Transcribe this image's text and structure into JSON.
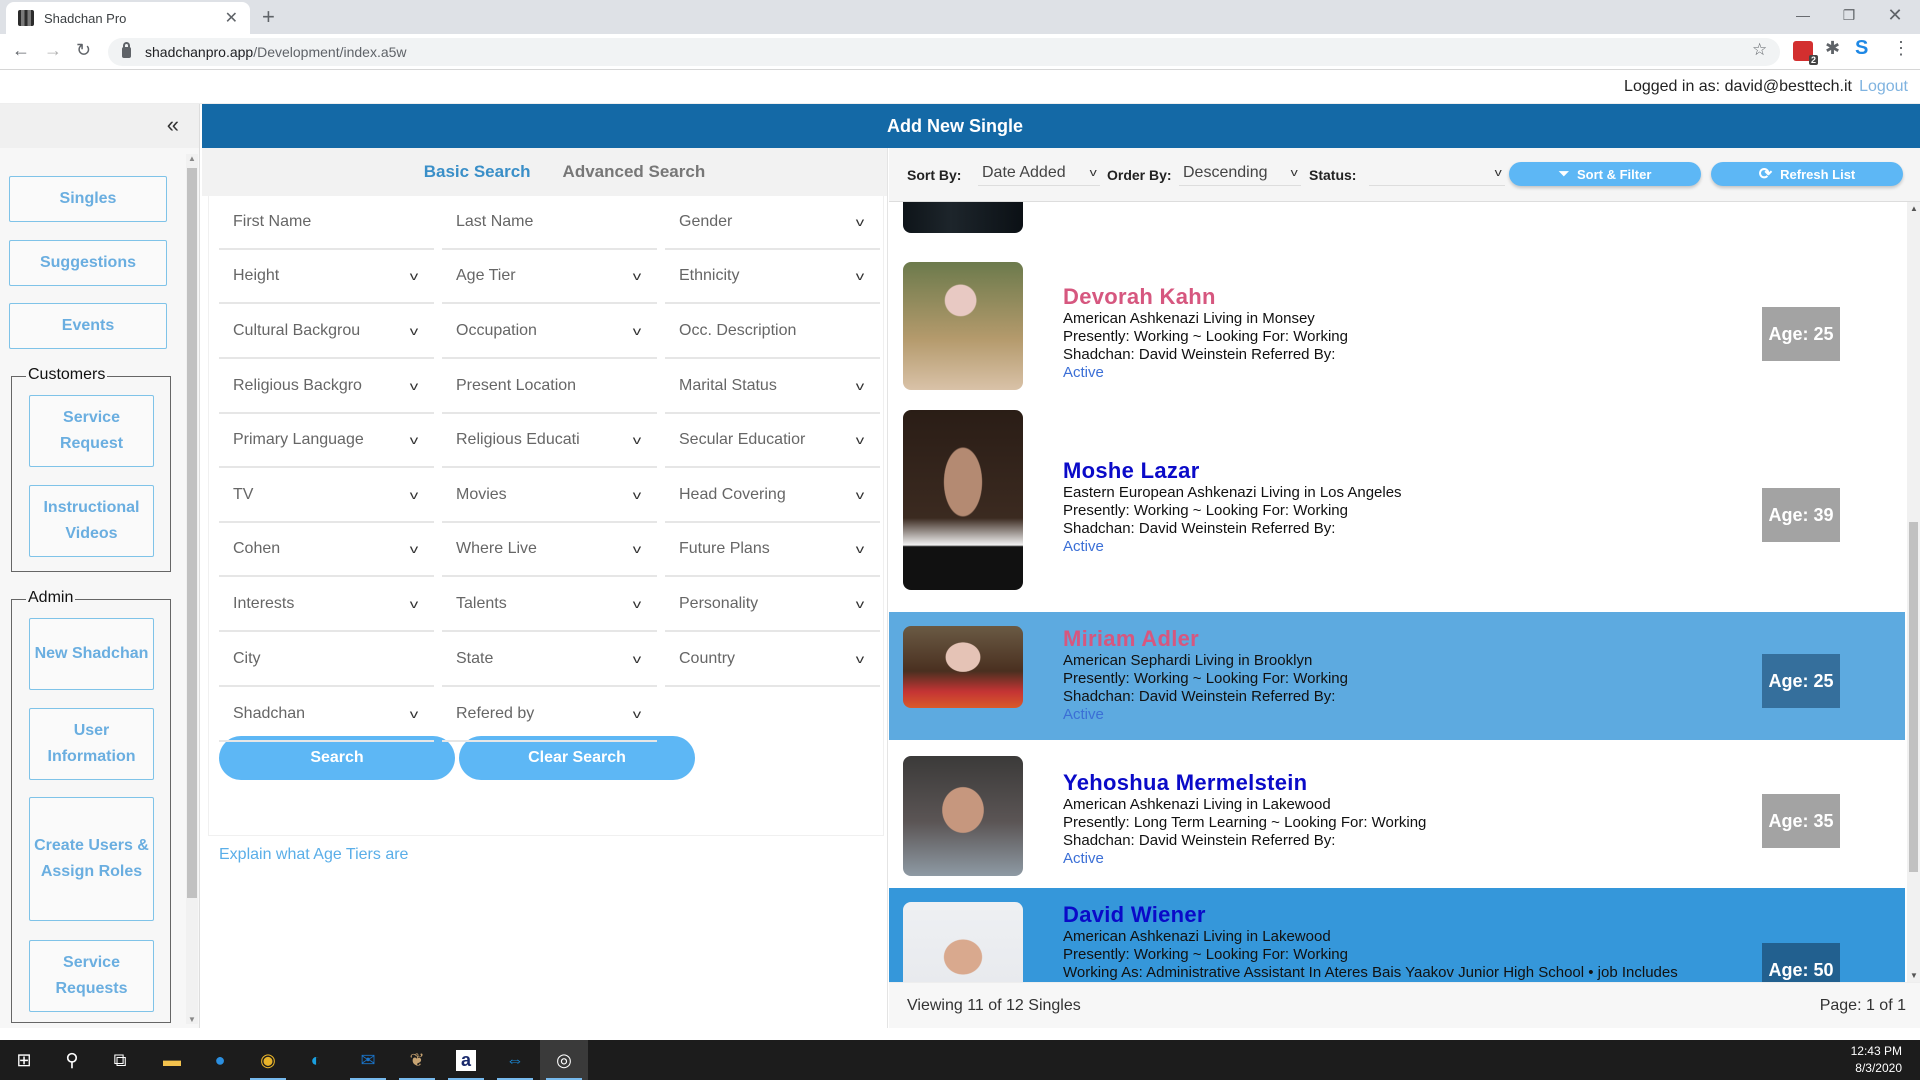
{
  "browser": {
    "tab_title": "Shadchan Pro",
    "url_host": "shadchanpro.app",
    "url_path": "/Development/index.a5w",
    "ext_badge": "2"
  },
  "login": {
    "text": "Logged in as: david@besttech.it",
    "logout": "Logout"
  },
  "sidebar": {
    "collapse_icon": "«",
    "items": [
      {
        "label": "Singles"
      },
      {
        "label": "Suggestions"
      },
      {
        "label": "Events"
      }
    ],
    "customers": {
      "legend": "Customers",
      "items": [
        {
          "label": "Service Request"
        },
        {
          "label": "Instructional Videos"
        }
      ]
    },
    "admin": {
      "legend": "Admin",
      "items": [
        {
          "label": "New Shadchan"
        },
        {
          "label": "User Information"
        },
        {
          "label": "Create Users & Assign Roles"
        },
        {
          "label": "Service Requests"
        }
      ]
    }
  },
  "header": {
    "title": "Add New Single"
  },
  "search": {
    "tabs": {
      "basic": "Basic Search",
      "advanced": "Advanced Search"
    },
    "fields": [
      {
        "label": "First Name",
        "dropdown": false
      },
      {
        "label": "Last Name",
        "dropdown": false
      },
      {
        "label": "Gender",
        "dropdown": true
      },
      {
        "label": "Height",
        "dropdown": true
      },
      {
        "label": "Age Tier",
        "dropdown": true
      },
      {
        "label": "Ethnicity",
        "dropdown": true
      },
      {
        "label": "Cultural Backgrou",
        "dropdown": true
      },
      {
        "label": "Occupation",
        "dropdown": true
      },
      {
        "label": "Occ. Description",
        "dropdown": false
      },
      {
        "label": "Religious Backgro",
        "dropdown": true
      },
      {
        "label": "Present Location",
        "dropdown": false
      },
      {
        "label": "Marital Status",
        "dropdown": true
      },
      {
        "label": "Primary Language",
        "dropdown": true
      },
      {
        "label": "Religious Educati",
        "dropdown": true
      },
      {
        "label": "Secular Educatior",
        "dropdown": true
      },
      {
        "label": "TV",
        "dropdown": true
      },
      {
        "label": "Movies",
        "dropdown": true
      },
      {
        "label": "Head Covering",
        "dropdown": true
      },
      {
        "label": "Cohen",
        "dropdown": true
      },
      {
        "label": "Where Live",
        "dropdown": true
      },
      {
        "label": "Future Plans",
        "dropdown": true
      },
      {
        "label": "Interests",
        "dropdown": true
      },
      {
        "label": "Talents",
        "dropdown": true
      },
      {
        "label": "Personality",
        "dropdown": true
      },
      {
        "label": "City",
        "dropdown": false
      },
      {
        "label": "State",
        "dropdown": true
      },
      {
        "label": "Country",
        "dropdown": true
      },
      {
        "label": "Shadchan",
        "dropdown": true
      },
      {
        "label": "Refered by",
        "dropdown": true
      }
    ],
    "search_button": "Search",
    "clear_button": "Clear Search",
    "explain_link": "Explain what Age Tiers are"
  },
  "sortbar": {
    "sort_by_label": "Sort By:",
    "sort_by_value": "Date Added",
    "order_by_label": "Order By:",
    "order_by_value": "Descending",
    "status_label": "Status:",
    "status_value": "",
    "sort_filter_button": "Sort & Filter",
    "refresh_button": "Refresh List"
  },
  "singles": [
    {
      "name": "Devorah  Kahn",
      "gender": "f",
      "line1": "American  Ashkenazi  Living in Monsey",
      "line2": "Presently: Working  ~ Looking For: Working",
      "line3": "Shadchan: David  Weinstein  Referred By:",
      "status": "Active",
      "age": "Age: 25",
      "highlight": "none"
    },
    {
      "name": "Moshe  Lazar",
      "gender": "m",
      "line1": "Eastern European  Ashkenazi  Living in Los Angeles",
      "line2": "Presently: Working  ~ Looking For: Working",
      "line3": "Shadchan: David  Weinstein  Referred By:",
      "status": "Active",
      "age": "Age: 39",
      "highlight": "none"
    },
    {
      "name": "Miriam  Adler",
      "gender": "f",
      "line1": "American  Sephardi  Living in Brooklyn",
      "line2": "Presently: Working  ~ Looking For: Working",
      "line3": "Shadchan: David  Weinstein  Referred By:",
      "status": "Active",
      "age": "Age: 25",
      "highlight": "hover"
    },
    {
      "name": "Yehoshua  Mermelstein",
      "gender": "m",
      "line1": "American  Ashkenazi  Living in Lakewood",
      "line2": "Presently: Long Term Learning  ~ Looking For: Working",
      "line3": "Shadchan: David  Weinstein  Referred By:",
      "status": "Active",
      "age": "Age: 35",
      "highlight": "none"
    },
    {
      "name": "David  Wiener",
      "gender": "m",
      "line1": "American  Ashkenazi  Living in Lakewood",
      "line2": "Presently: Working  ~ Looking For: Working",
      "line3": "Working As: Administrative Assistant In Ateres Bais Yaakov Junior High School • job Includes",
      "status": "",
      "age": "Age: 50",
      "highlight": "selected"
    }
  ],
  "footer": {
    "viewing": "Viewing 11 of 12 Singles",
    "page": "Page: 1 of 1"
  },
  "taskbar": {
    "time": "12:43 PM",
    "date": "8/3/2020"
  },
  "colors": {
    "header_blue": "#1469a6",
    "accent_button": "#5db7f5",
    "female_name": "#d6577f",
    "male_name": "#0a0ac8",
    "status_link": "#3b6fd6",
    "hover_row": "#5daae0",
    "selected_row": "#3597da"
  }
}
